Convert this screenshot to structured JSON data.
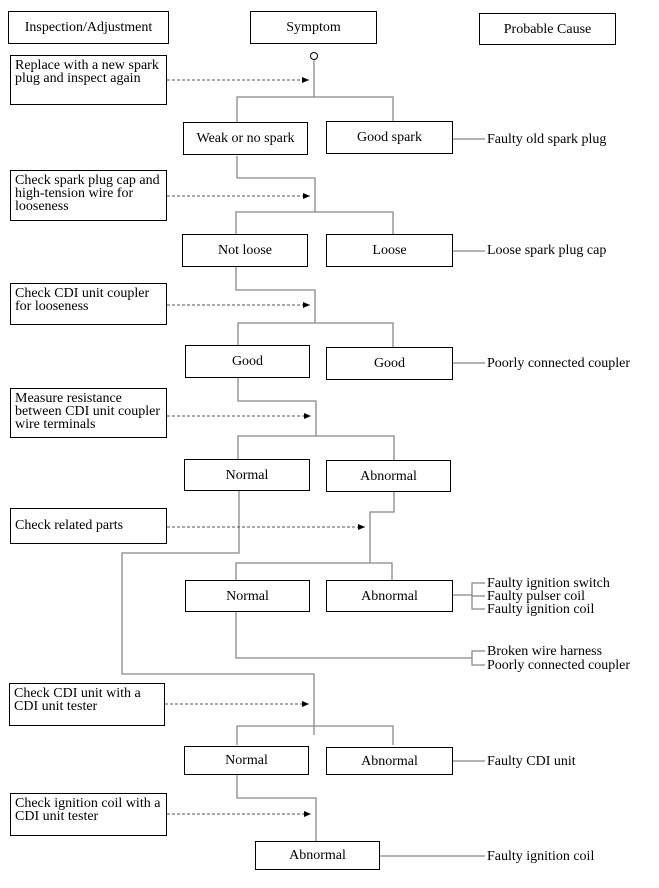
{
  "headers": {
    "inspection": "Inspection/Adjustment",
    "symptom": "Symptom",
    "cause": "Probable Cause"
  },
  "steps": [
    {
      "text": "Replace with a new spark plug and inspect again"
    },
    {
      "text": "Check spark plug cap and high-tension wire for looseness"
    },
    {
      "text": "Check CDI unit coupler for looseness"
    },
    {
      "text": "Measure resistance between CDI unit coupler wire terminals"
    },
    {
      "text": "Check related parts"
    },
    {
      "text": "Check CDI unit with a CDI unit tester"
    },
    {
      "text": "Check ignition coil with a CDI unit tester"
    }
  ],
  "symptoms": [
    {
      "left": "Weak or no spark",
      "right": "Good spark"
    },
    {
      "left": "Not loose",
      "right": "Loose"
    },
    {
      "left": "Good",
      "right": "Good"
    },
    {
      "left": "Normal",
      "right": "Abnormal"
    },
    {
      "left": "Normal",
      "right": "Abnormal"
    },
    {
      "left": "Normal",
      "right": "Abnormal"
    },
    {
      "single": "Abnormal"
    }
  ],
  "causes": {
    "c1": "Faulty old spark plug",
    "c2": "Loose spark plug cap",
    "c3": "Poorly connected coupler",
    "c5a": "Faulty ignition switch",
    "c5b": "Faulty pulser coil",
    "c5c": "Faulty ignition coil",
    "c5d": "Broken wire harness",
    "c5e": "Poorly connected coupler",
    "c6": "Faulty CDI unit",
    "c7": "Faulty ignition coil"
  }
}
